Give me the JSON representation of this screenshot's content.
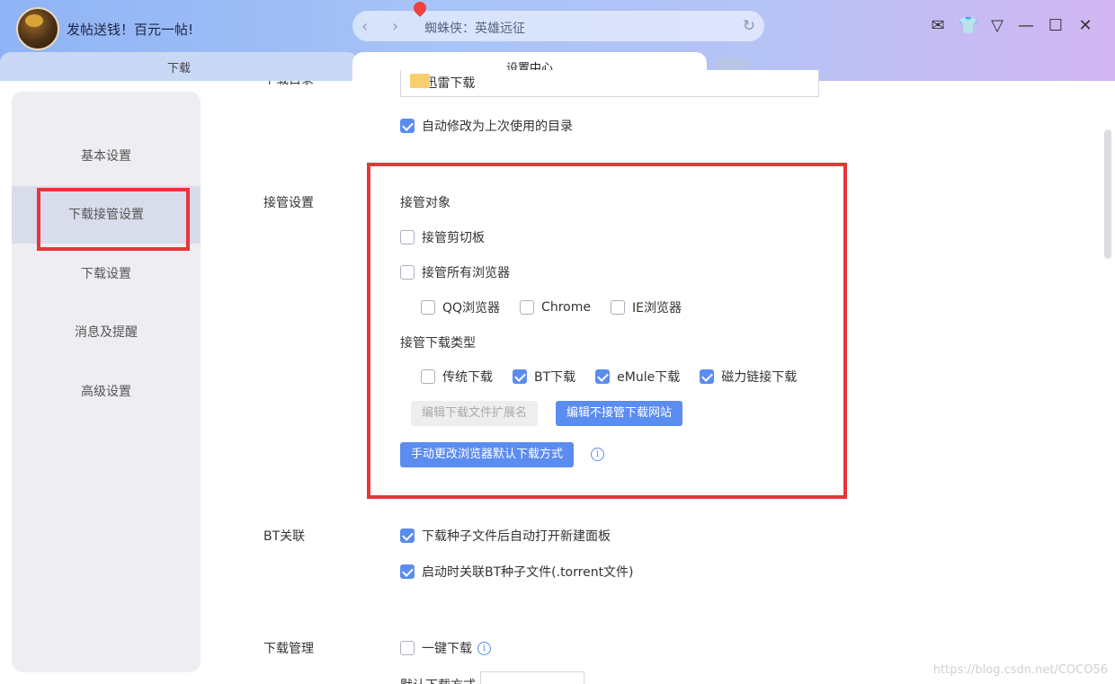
{
  "titlebar": {
    "promo": "发帖送钱！百元一帖!",
    "address": "蜘蛛侠：英雄远征"
  },
  "tabs": [
    {
      "label": "下载"
    },
    {
      "label": "设置中心"
    }
  ],
  "sidebar": {
    "items": [
      {
        "label": "基本设置"
      },
      {
        "label": "下载接管设置"
      },
      {
        "label": "下载设置"
      },
      {
        "label": "消息及提醒"
      },
      {
        "label": "高级设置"
      }
    ]
  },
  "download_dir": {
    "label": "下载目录",
    "value": "F:\\迅雷下载",
    "auto_modify": {
      "label": "自动修改为上次使用的目录",
      "checked": true
    }
  },
  "takeover": {
    "label": "接管设置",
    "target_heading": "接管对象",
    "clipboard": {
      "label": "接管剪切板",
      "checked": false
    },
    "all_browsers": {
      "label": "接管所有浏览器",
      "checked": false
    },
    "browsers": [
      {
        "label": "QQ浏览器",
        "checked": false
      },
      {
        "label": "Chrome",
        "checked": false
      },
      {
        "label": "IE浏览器",
        "checked": false
      }
    ],
    "type_heading": "接管下载类型",
    "types": [
      {
        "label": "传统下载",
        "checked": false
      },
      {
        "label": "BT下载",
        "checked": true
      },
      {
        "label": "eMule下载",
        "checked": true
      },
      {
        "label": "磁力链接下载",
        "checked": true
      }
    ],
    "edit_ext_button": "编辑下载文件扩展名",
    "edit_sites_button": "编辑不接管下载网站",
    "change_default_button": "手动更改浏览器默认下载方式",
    "info_icon": "i"
  },
  "bt": {
    "label": "BT关联",
    "auto_open": {
      "label": "下载种子文件后自动打开新建面板",
      "checked": true
    },
    "associate": {
      "label": "启动时关联BT种子文件(.torrent文件)",
      "checked": true
    }
  },
  "download_mgmt": {
    "label": "下载管理",
    "one_click": {
      "label": "一键下载",
      "checked": false
    },
    "default_mode_label": "默认下载方式"
  },
  "watermark": "https://blog.csdn.net/COCO56",
  "colors": {
    "accent": "#5b8cf0",
    "highlight": "#e8353a"
  }
}
